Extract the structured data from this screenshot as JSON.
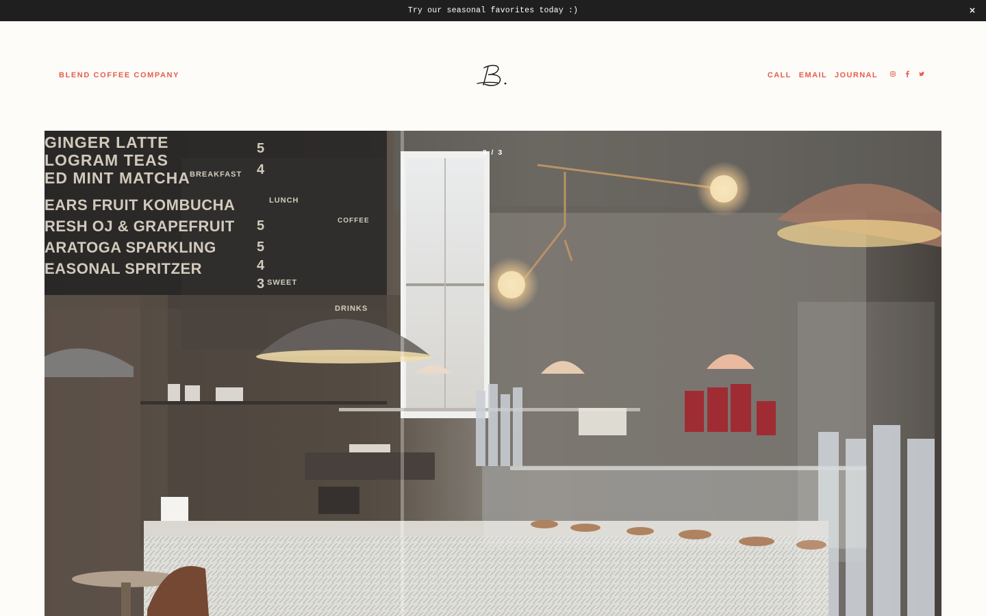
{
  "announcement": {
    "text": "Try our seasonal favorites today :)",
    "close_label": "×"
  },
  "header": {
    "brand": "BLEND COFFEE COMPANY",
    "logo_mark": "B.",
    "nav": [
      {
        "label": "CALL"
      },
      {
        "label": "EMAIL"
      },
      {
        "label": "JOURNAL"
      }
    ],
    "social_icons": [
      "instagram-icon",
      "facebook-icon",
      "twitter-icon"
    ]
  },
  "hero": {
    "slide_counter": "3 / 3",
    "menu_board_lines": [
      "GINGER LATTE",
      "LOGRAM TEAS",
      "ED MINT MATCHA",
      "EARS FRUIT KOMBUCHA",
      "RESH OJ & GRAPEFRUIT",
      "ARATOGA SPARKLING",
      "EASONAL SPRITZER"
    ],
    "menu_board_prices": [
      "5",
      "4",
      "5",
      "5",
      "4",
      "3"
    ],
    "small_menu_headings": [
      "BREAKFAST",
      "LUNCH",
      "COFFEE",
      "SWEET",
      "DRINKS"
    ]
  },
  "colors": {
    "accent": "#e85b4a",
    "announcement_bg": "#1f1f1f",
    "page_bg": "#fdfcf9"
  }
}
